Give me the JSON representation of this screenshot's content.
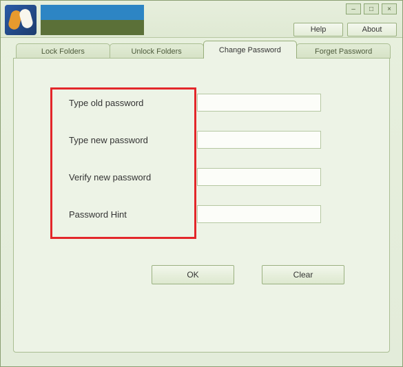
{
  "header": {
    "help_label": "Help",
    "about_label": "About"
  },
  "tabs": [
    {
      "label": "Lock Folders"
    },
    {
      "label": "Unlock Folders"
    },
    {
      "label": "Change Password"
    },
    {
      "label": "Forget Password"
    }
  ],
  "active_tab_index": 2,
  "form": {
    "fields": [
      {
        "label": "Type old password",
        "value": ""
      },
      {
        "label": "Type new password",
        "value": ""
      },
      {
        "label": "Verify new password",
        "value": ""
      },
      {
        "label": "Password Hint",
        "value": ""
      }
    ],
    "ok_label": "OK",
    "clear_label": "Clear"
  },
  "window_controls": {
    "minimize": "–",
    "maximize": "□",
    "close": "×"
  }
}
